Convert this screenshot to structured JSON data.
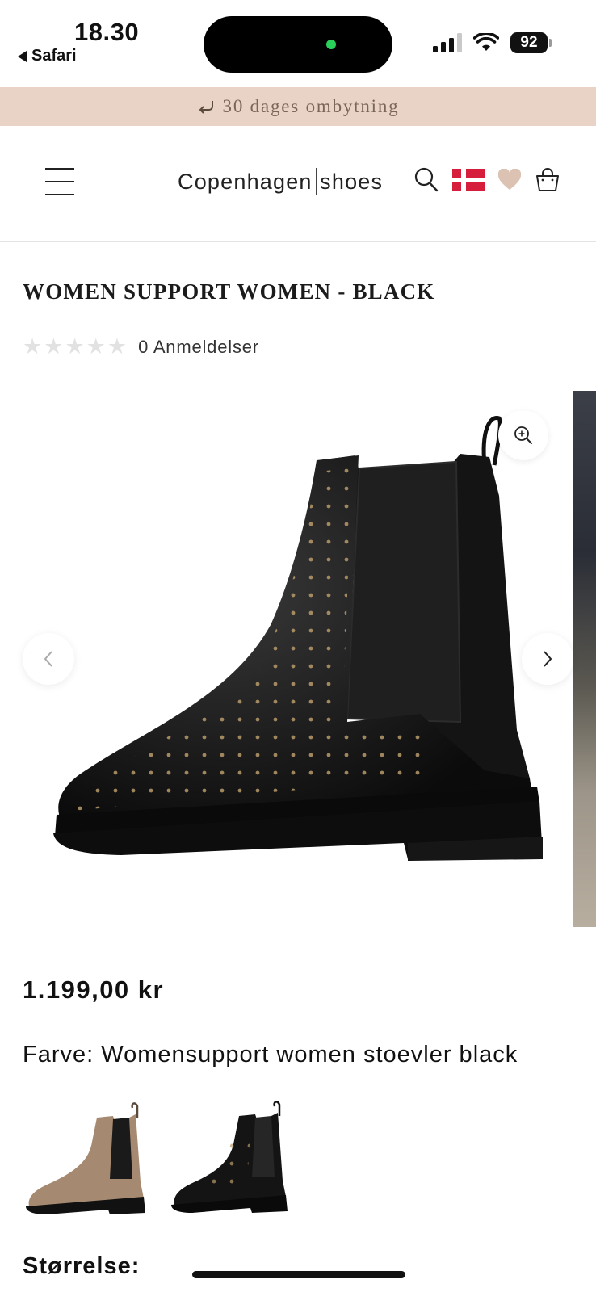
{
  "status_bar": {
    "time": "18.30",
    "back_app": "Safari",
    "battery": "92"
  },
  "announcement": {
    "icon": "return-arrow-icon",
    "text": "30 dages ombytning",
    "bg_color": "#e8d3c6"
  },
  "header": {
    "logo_left": "Copenhagen",
    "logo_right": "shoes",
    "icons": [
      "menu-icon",
      "search-icon",
      "danish-flag-icon",
      "heart-icon",
      "shopping-bag-icon"
    ]
  },
  "product": {
    "title": "WOMEN SUPPORT WOMEN - BLACK",
    "rating": 0,
    "reviews_label": "0 Anmeldelser",
    "price": "1.199,00 kr",
    "color_label": "Farve: Womensupport women stoevler black",
    "swatches": [
      "beige-boot-swatch",
      "black-boot-swatch"
    ],
    "size_label": "Størrelse:"
  },
  "colors": {
    "accent_heart": "#dcc2b2",
    "flag_red": "#d71d3c"
  }
}
